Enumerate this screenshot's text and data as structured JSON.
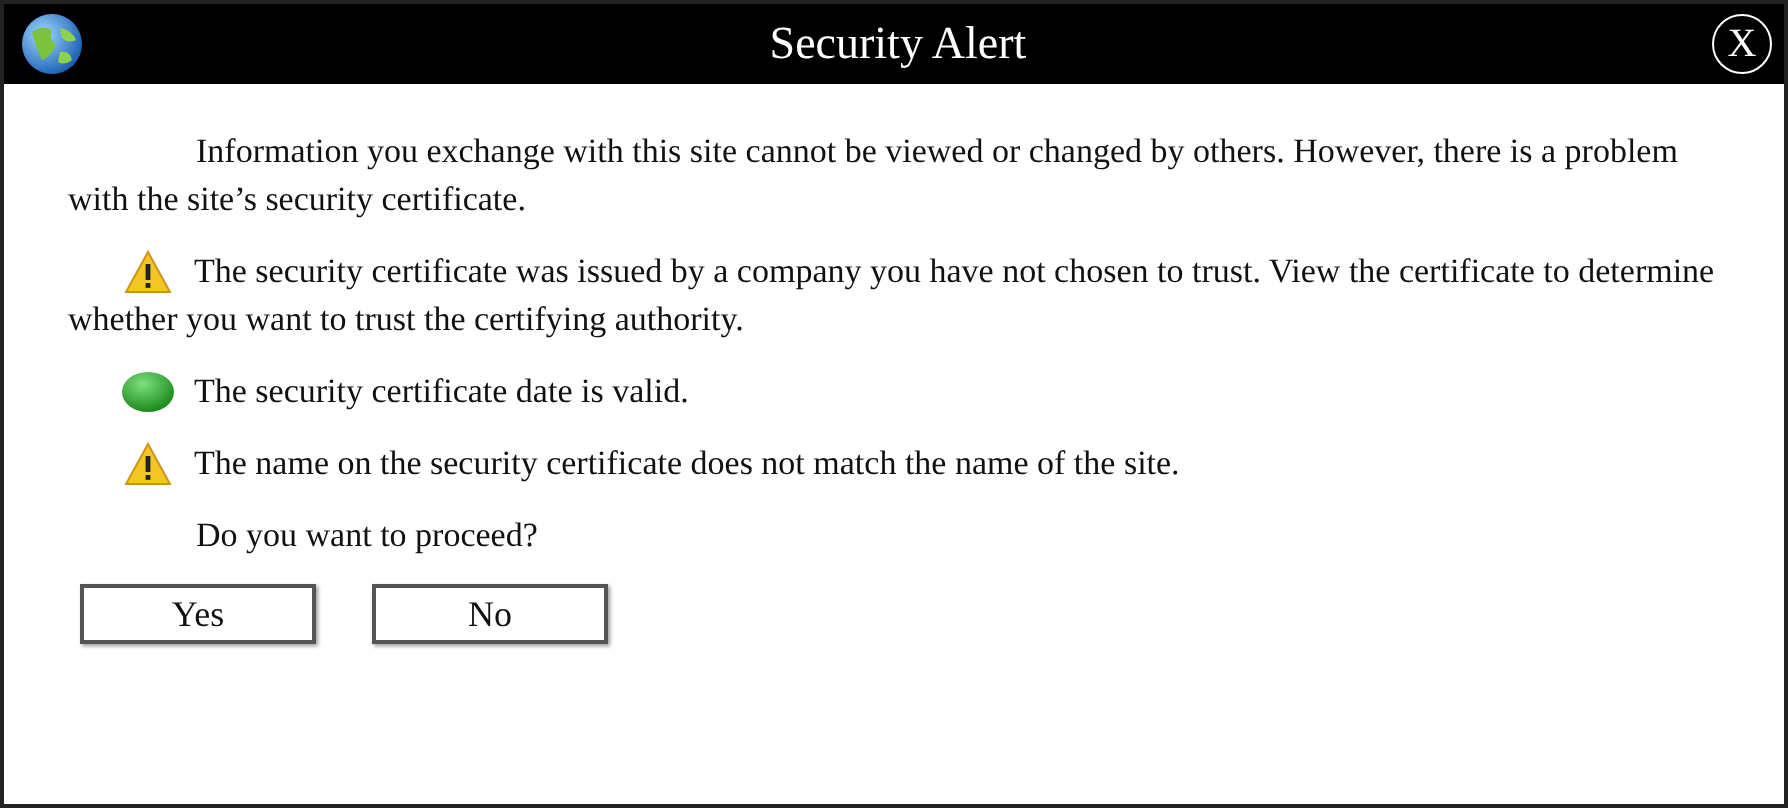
{
  "window": {
    "title": "Security Alert",
    "close": "X"
  },
  "intro": "Information you exchange with this site cannot be viewed or changed by others. However, there is a problem with the site’s security certificate.",
  "messages": [
    {
      "kind": "warning",
      "text": "The security certificate was issued by a company you have not chosen to trust. View the certificate to determine whether you want to trust the certifying authority."
    },
    {
      "kind": "valid",
      "text": "The security certificate date is valid."
    },
    {
      "kind": "warning",
      "text": "The name on the security certificate does not match the name of the site."
    }
  ],
  "question": "Do you want to proceed?",
  "buttons": [
    "Yes",
    "No"
  ]
}
